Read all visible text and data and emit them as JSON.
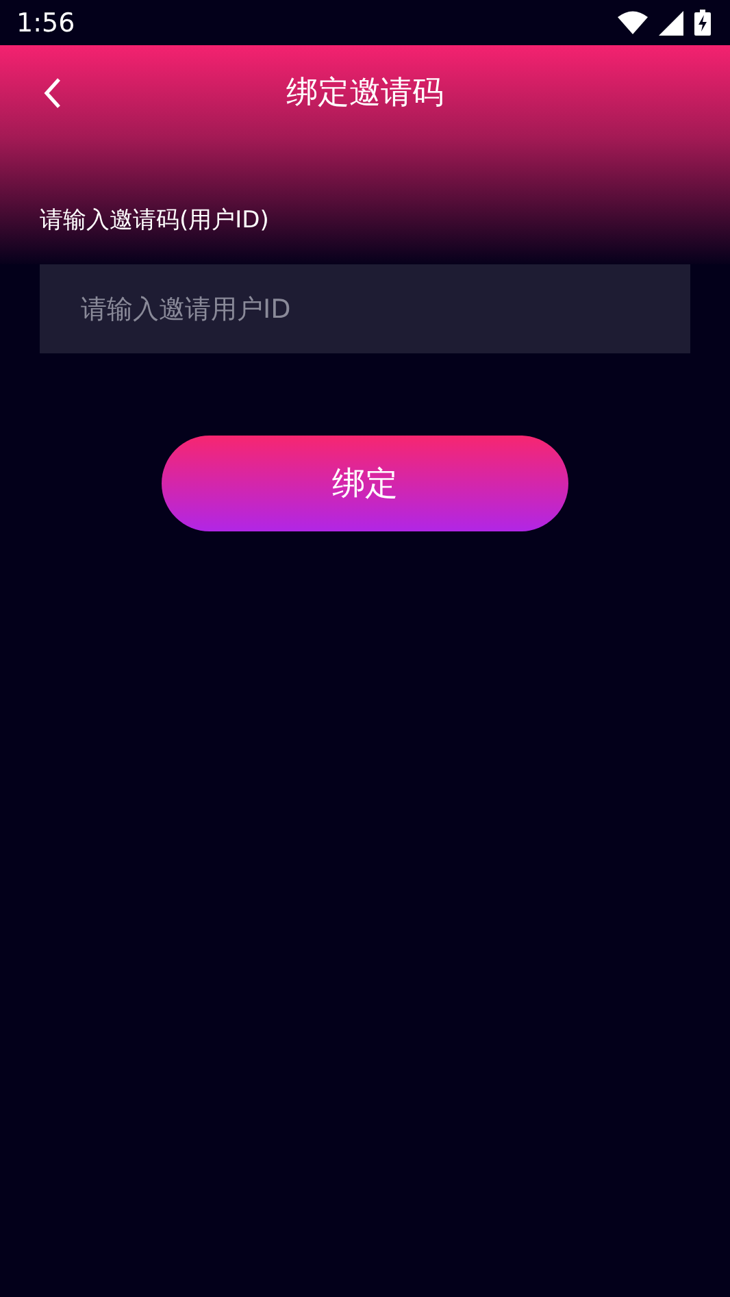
{
  "status_bar": {
    "time": "1:56"
  },
  "header": {
    "title": "绑定邀请码"
  },
  "form": {
    "label": "请输入邀请码(用户ID)",
    "input": {
      "placeholder": "请输入邀请用户ID"
    }
  },
  "buttons": [
    {
      "label": "绑定"
    }
  ]
}
